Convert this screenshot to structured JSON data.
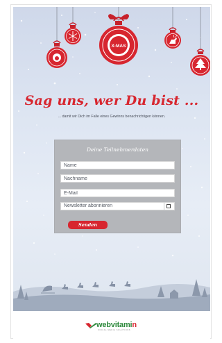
{
  "headline": "Sag uns, wer Du bist ...",
  "subline": "... damit wir Dich im Falle eines Gewinns benachrichtigen können.",
  "ornaments": {
    "center_label": "X-MAS"
  },
  "form": {
    "title": "Deine Teilnehmerdaten",
    "fields": {
      "name_placeholder": "Name",
      "lastname_placeholder": "Nachname",
      "email_placeholder": "E-Mail"
    },
    "newsletter_label": "Newsletter abonnieren",
    "newsletter_checked": false,
    "submit_label": "Senden"
  },
  "footer": {
    "logo_text_main": "webvitami",
    "logo_text_accent": "n",
    "logo_tagline": "SOCIAL MEDIA SOLUTIONS"
  },
  "colors": {
    "accent_red": "#d7262f",
    "form_gray": "#b4b6ba",
    "logo_green": "#2f8a3e"
  }
}
